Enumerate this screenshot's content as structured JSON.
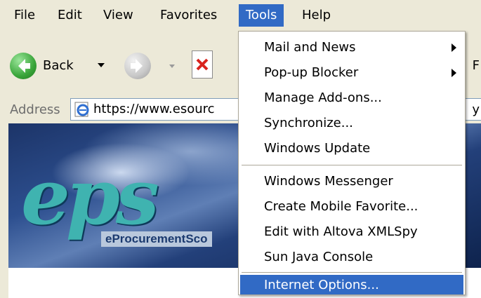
{
  "menubar": {
    "items": [
      "File",
      "Edit",
      "View",
      "Favorites",
      "Tools",
      "Help"
    ],
    "active": "Tools"
  },
  "toolbar": {
    "back_label": "Back",
    "partial_label": "F"
  },
  "address": {
    "label": "Address",
    "url_visible": "https://www.esourc",
    "right_fragment": "y"
  },
  "page": {
    "logo_text": "eps",
    "tagline_visible": "eProcurementSco"
  },
  "tools_menu": {
    "items": [
      {
        "label": "Mail and News",
        "submenu": true
      },
      {
        "label": "Pop-up Blocker",
        "submenu": true
      },
      {
        "label": "Manage Add-ons..."
      },
      {
        "label": "Synchronize..."
      },
      {
        "label": "Windows Update"
      },
      {
        "label": "Windows Messenger"
      },
      {
        "label": "Create Mobile Favorite..."
      },
      {
        "label": "Edit with Altova XMLSpy"
      },
      {
        "label": "Sun Java Console"
      },
      {
        "label": "Internet Options...",
        "highlighted": true
      }
    ]
  },
  "colors": {
    "highlight": "#316ac5",
    "chrome": "#ece9d8",
    "back_green": "#3aa53a",
    "logo_teal": "#3fb3b0"
  }
}
